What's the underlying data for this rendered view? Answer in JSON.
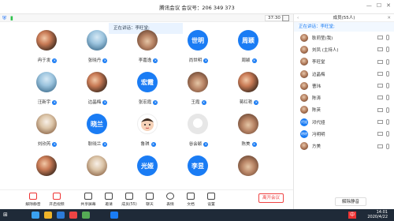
{
  "titlebar": {
    "title": "腾讯会议 会议号：206 349 373"
  },
  "subbar": {
    "timer": "37:30"
  },
  "speaking_banner": "正在讲话：李旺堂;",
  "tiles": [
    {
      "name": "冉于发",
      "kind": "photo"
    },
    {
      "name": "张晓丹",
      "kind": "photo2"
    },
    {
      "name": "李嘉逸",
      "kind": "photo3"
    },
    {
      "name": "尚世明",
      "kind": "text",
      "avatar_text": "世明"
    },
    {
      "name": "周颖",
      "kind": "text",
      "avatar_text": "周颖"
    },
    {
      "name": "汪新宇",
      "kind": "photo2"
    },
    {
      "name": "边晶梅",
      "kind": "photo"
    },
    {
      "name": "张宏霞",
      "kind": "text",
      "avatar_text": "宏霞"
    },
    {
      "name": "王霞",
      "kind": "photo3"
    },
    {
      "name": "蒋红艳",
      "kind": "photo"
    },
    {
      "name": "刘欣芮",
      "kind": "photo4"
    },
    {
      "name": "耿晓兰",
      "kind": "text",
      "avatar_text": "晓兰"
    },
    {
      "name": "鲁琪",
      "kind": "cartoon"
    },
    {
      "name": "谷会颖",
      "kind": "ghost"
    },
    {
      "name": "陈美",
      "kind": "photo3"
    },
    {
      "name": "",
      "kind": "photo"
    },
    {
      "name": "",
      "kind": "photo4"
    },
    {
      "name": "",
      "kind": "text",
      "avatar_text": "光娅"
    },
    {
      "name": "",
      "kind": "text",
      "avatar_text": "李昱"
    },
    {
      "name": "",
      "kind": "photo3"
    }
  ],
  "toolbar": [
    {
      "label": "解除静音",
      "red": true
    },
    {
      "label": "开启视频",
      "red": true
    },
    {
      "label": "共享屏幕"
    },
    {
      "label": "邀请"
    },
    {
      "label": "成员(55)"
    },
    {
      "label": "聊天"
    },
    {
      "label": "表情"
    },
    {
      "label": "文档"
    },
    {
      "label": "设置"
    }
  ],
  "leave_label": "离开会议",
  "members_panel": {
    "header": "成员(55人)",
    "speaking": "正在讲话：李旺堂;",
    "members": [
      {
        "name": "耿莉莹(我)",
        "txt": ""
      },
      {
        "name": "刘凤 (主持人)",
        "txt": ""
      },
      {
        "name": "李旺堂",
        "txt": ""
      },
      {
        "name": "边晶梅",
        "txt": ""
      },
      {
        "name": "曹玮",
        "txt": ""
      },
      {
        "name": "陈涛",
        "txt": ""
      },
      {
        "name": "陈英",
        "txt": ""
      },
      {
        "name": "邓代娅",
        "txt": "代娅"
      },
      {
        "name": "冯明明",
        "txt": "明明"
      },
      {
        "name": "方美",
        "txt": ""
      }
    ],
    "unmute_all": "解除静音"
  },
  "taskbar": {
    "time": "14:01",
    "date": "2020/4/22",
    "ime": "中"
  }
}
